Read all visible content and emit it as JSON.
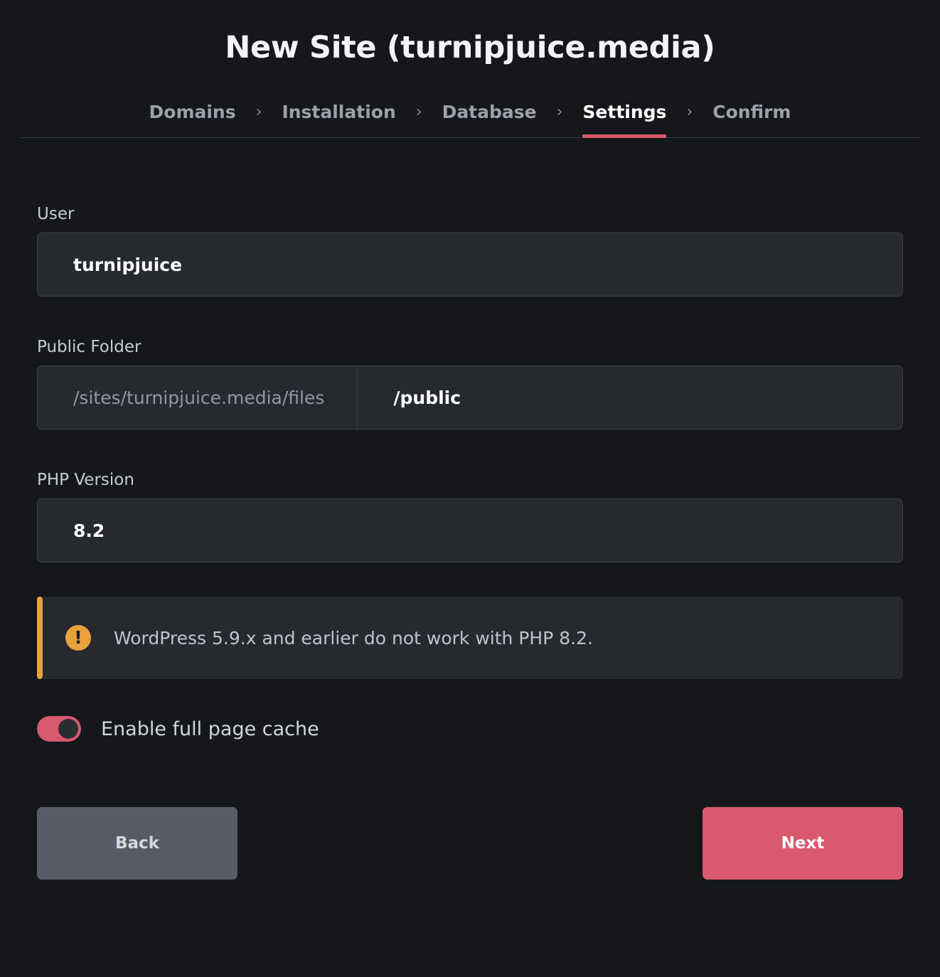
{
  "window": {
    "title": "New Site (turnipjuice.media)"
  },
  "wizard": {
    "chevron": "›",
    "steps": [
      {
        "label": "Domains",
        "active": false
      },
      {
        "label": "Installation",
        "active": false
      },
      {
        "label": "Database",
        "active": false
      },
      {
        "label": "Settings",
        "active": true
      },
      {
        "label": "Confirm",
        "active": false
      }
    ]
  },
  "form": {
    "user": {
      "label": "User",
      "value": "turnipjuice"
    },
    "public_folder": {
      "label": "Public Folder",
      "prefix": "/sites/turnipjuice.media/files",
      "value": "/public"
    },
    "php_version": {
      "label": "PHP Version",
      "value": "8.2"
    },
    "alert": {
      "icon": "warning-exclamation-icon",
      "icon_glyph": "!",
      "text": "WordPress 5.9.x and earlier do not work with PHP 8.2."
    },
    "full_page_cache": {
      "label": "Enable full page cache",
      "state": "on"
    }
  },
  "actions": {
    "back_label": "Back",
    "next_label": "Next"
  },
  "colors": {
    "background": "#15171a",
    "accent_pink": "#d9596e",
    "warning_orange": "#e8a13c",
    "field_bg": "#26292e",
    "field_border": "#3b3f46",
    "back_button_bg": "#565b67"
  }
}
